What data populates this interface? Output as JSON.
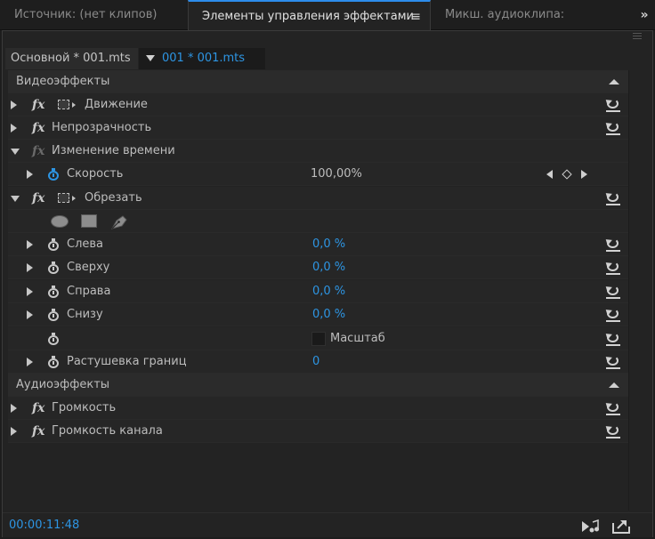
{
  "tabs": [
    {
      "label": "Источник: (нет клипов)"
    },
    {
      "label": "Элементы управления эффектами"
    },
    {
      "label": "Микш. аудиоклипа:"
    }
  ],
  "tab_menu_icon": "≡",
  "tab_more_icon": "»",
  "clips": {
    "master": "Основной * 001.mts",
    "sequence": "001 * 001.mts"
  },
  "sections": {
    "video": "Видеоэффекты",
    "audio": "Аудиоэффекты"
  },
  "effects": {
    "motion": "Движение",
    "opacity": "Непрозрачность",
    "time_remap": "Изменение времени",
    "speed_label": "Скорость",
    "speed_value": "100,00%",
    "crop": "Обрезать",
    "volume": "Громкость",
    "channel_volume": "Громкость канала"
  },
  "fx_glyph": "fx",
  "crop_props": [
    {
      "label": "Слева",
      "value": "0,0 %"
    },
    {
      "label": "Сверху",
      "value": "0,0 %"
    },
    {
      "label": "Справа",
      "value": "0,0 %"
    },
    {
      "label": "Снизу",
      "value": "0,0 %"
    }
  ],
  "zoom_label": "Масштаб",
  "feather": {
    "label": "Растушевка границ",
    "value": "0"
  },
  "timecode": "00:00:11:48",
  "colors": {
    "accent": "#2d95e3",
    "panel_bg": "#232323",
    "row_bg": "#262626",
    "section_bg": "#2b2b2b",
    "text": "#bdbdbd"
  },
  "icons": [
    "reset-icon",
    "stopwatch-icon",
    "motion-icon",
    "ellipse-mask-icon",
    "rectangle-mask-icon",
    "pen-mask-icon",
    "keyframe-prev-icon",
    "keyframe-add-icon",
    "keyframe-next-icon",
    "play-audio-icon",
    "export-icon"
  ]
}
